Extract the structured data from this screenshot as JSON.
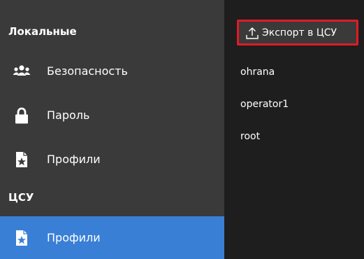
{
  "sidebar": {
    "local_header": "Локальные",
    "local_items": [
      {
        "label": "Безопасность",
        "icon": "users-icon"
      },
      {
        "label": "Пароль",
        "icon": "lock-icon"
      },
      {
        "label": "Профили",
        "icon": "profile-file-icon"
      }
    ],
    "csu_header": "ЦСУ",
    "csu_items": [
      {
        "label": "Профили",
        "icon": "profile-file-icon",
        "active": true
      }
    ]
  },
  "toolbar": {
    "export_label": "Экспорт в ЦСУ",
    "export_icon": "upload-icon"
  },
  "users": [
    "ohrana",
    "operator1",
    "root"
  ],
  "colors": {
    "sidebar_bg": "#3a3a3a",
    "content_bg": "#1e1e1e",
    "active_bg": "#3a7fd6",
    "highlight_border": "#e01b24"
  }
}
